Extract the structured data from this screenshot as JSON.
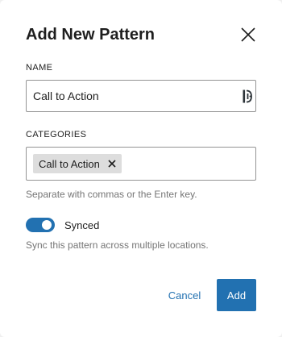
{
  "modal": {
    "title": "Add New Pattern",
    "close_icon": "close-icon"
  },
  "name_field": {
    "label": "NAME",
    "value": "Call to Action",
    "trailing_icon": "password-manager-icon"
  },
  "categories_field": {
    "label": "CATEGORIES",
    "tokens": [
      {
        "label": "Call to Action",
        "remove_icon": "close-icon"
      }
    ],
    "help": "Separate with commas or the Enter key."
  },
  "synced": {
    "label": "Synced",
    "checked": true,
    "help": "Sync this pattern across multiple locations."
  },
  "actions": {
    "cancel_label": "Cancel",
    "add_label": "Add"
  },
  "colors": {
    "accent": "#2271b1",
    "token_bg": "#dddddd",
    "help_text": "#757575",
    "border": "#949494"
  }
}
